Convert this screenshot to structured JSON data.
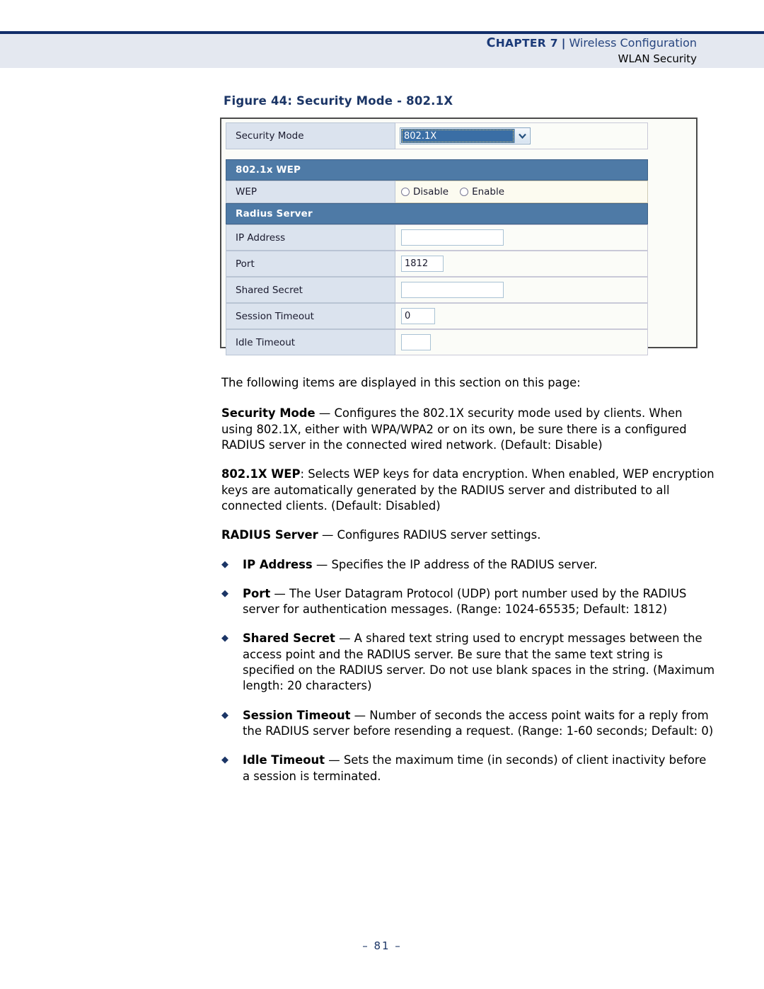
{
  "header": {
    "chapter_label_cap": "C",
    "chapter_label_rest": "HAPTER",
    "chapter_number": "7",
    "separator": "|",
    "section": "Wireless Configuration",
    "subsection": "WLAN Security"
  },
  "figure": {
    "caption": "Figure 44:  Security Mode - 802.1X",
    "rows": {
      "security_mode": {
        "label": "Security Mode",
        "selected_value": "802.1X",
        "arrow_glyph": "⌃"
      },
      "wep_section": {
        "label": "802.1x WEP"
      },
      "wep": {
        "label": "WEP",
        "option_disable": "Disable",
        "option_enable": "Enable"
      },
      "radius_section": {
        "label": "Radius Server"
      },
      "ip_address": {
        "label": "IP Address",
        "value": ""
      },
      "port": {
        "label": "Port",
        "value": "1812"
      },
      "shared_secret": {
        "label": "Shared Secret",
        "value": ""
      },
      "session_timeout": {
        "label": "Session Timeout",
        "value": "0"
      },
      "idle_timeout": {
        "label": "Idle Timeout",
        "value": ""
      }
    }
  },
  "body": {
    "intro": "The following items are displayed in this section on this page:",
    "security_mode": {
      "term": "Security Mode",
      "rest": " — Configures the 802.1X security mode used by clients. When using 802.1X, either with WPA/WPA2 or on its own, be sure there is a configured RADIUS server in the connected wired network. (Default: Disable)"
    },
    "wep": {
      "term": "802.1X WEP",
      "rest": ": Selects WEP keys for data encryption. When enabled, WEP encryption keys are automatically generated by the RADIUS server and distributed to all connected clients. (Default: Disabled)"
    },
    "radius_server": {
      "term": "RADIUS Server",
      "rest": " — Configures RADIUS server settings."
    },
    "bullet_glyph": "◆",
    "bullets": [
      {
        "term": "IP Address",
        "rest": " — Specifies the IP address of the RADIUS server."
      },
      {
        "term": "Port",
        "rest": " — The User Datagram Protocol (UDP) port number used by the RADIUS server for authentication messages. (Range: 1024-65535; Default: 1812)"
      },
      {
        "term": "Shared Secret",
        "rest": " — A shared text string used to encrypt messages between the access point and the RADIUS server. Be sure that the same text string is specified on the RADIUS server. Do not use blank spaces in the string. (Maximum length: 20 characters)"
      },
      {
        "term": "Session Timeout",
        "rest": " — Number of seconds the access point waits for a reply from the RADIUS server before resending a request. (Range: 1-60 seconds; Default: 0)"
      },
      {
        "term": "Idle Timeout",
        "rest": " — Sets the maximum time (in seconds) of client inactivity before a session is terminated."
      }
    ]
  },
  "footer": {
    "page_number": "–  81  –"
  },
  "colors": {
    "rule": "#112d69",
    "header_band": "#e4e8f0",
    "heading_navy": "#1b3566",
    "section_bar": "#4e7aa6",
    "label_cell": "#dbe3ee",
    "select_highlight": "#3a6ea5"
  }
}
